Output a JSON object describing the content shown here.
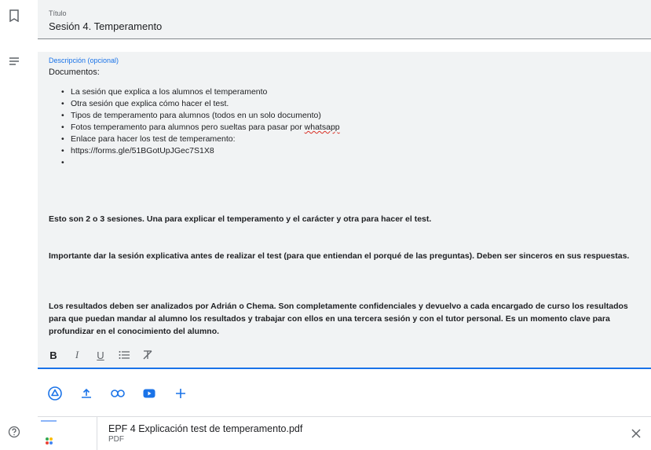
{
  "title": {
    "label": "Título",
    "value": "Sesión 4. Temperamento"
  },
  "description": {
    "label": "Descripción (opcional)",
    "heading": "Documentos:",
    "items": [
      "La sesión que explica a los alumnos el temperamento",
      "Otra sesión que explica cómo hacer el test.",
      "Tipos de temperamento para alumnos (todos en un solo documento)",
      "Enlace para hacer los test de temperamento:",
      "https://forms.gle/51BGotUpJGec7S1X8",
      ""
    ],
    "whatsapp_item_prefix": "Fotos temperamento para alumnos pero sueltas para pasar por ",
    "whatsapp_word": "whatsapp",
    "paragraph1": "Esto son 2 o 3 sesiones. Una para explicar el temperamento y el carácter y otra para hacer el test.",
    "paragraph2": "Importante dar la sesión explicativa antes de realizar el test (para que entiendan el porqué de las preguntas). Deben ser sinceros en sus respuestas.",
    "paragraph3": "Los resultados deben ser analizados por Adrián o Chema. Son completamente confidenciales y devuelvo a cada encargado de curso los resultados para que puedan mandar al alumno los resultados y trabajar con ellos en una tercera sesión y con el tutor personal. Es un momento clave para profundizar en el conocimiento del alumno."
  },
  "format_bar": {
    "bold": "B",
    "italic": "I",
    "underline": "U"
  },
  "attachment": {
    "file_name": "EPF 4 Explicación test de temperamento.pdf",
    "file_type": "PDF"
  },
  "colors": {
    "accent": "#1a73e8",
    "field_bg": "#f1f3f4",
    "icon_gray": "#5f6368"
  }
}
